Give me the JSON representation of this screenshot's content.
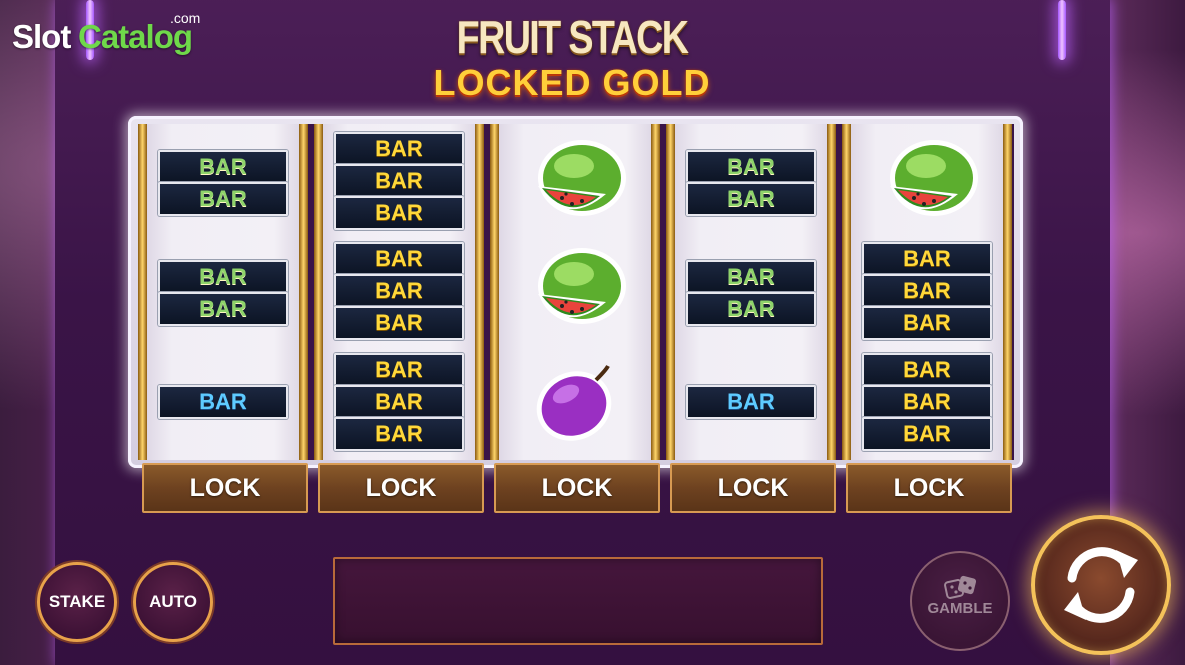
{
  "watermark": {
    "part1": "Slot",
    "part2": "Catalog",
    "suffix": ".com"
  },
  "game_title": {
    "line1": "FRUIT STACK",
    "line2": "LOCKED GOLD"
  },
  "reels": [
    {
      "symbols": [
        {
          "type": "bar",
          "label": "BAR",
          "color": "green"
        },
        {
          "type": "bar",
          "label": "BAR",
          "color": "green"
        },
        {
          "type": "bar",
          "label": "BAR",
          "color": "green"
        },
        {
          "type": "bar",
          "label": "BAR",
          "color": "green"
        },
        {
          "type": "bar",
          "label": "BAR",
          "color": "blue"
        }
      ]
    },
    {
      "symbols": [
        {
          "type": "bar",
          "label": "BAR",
          "color": "yellow"
        },
        {
          "type": "bar",
          "label": "BAR",
          "color": "yellow"
        },
        {
          "type": "bar",
          "label": "BAR",
          "color": "yellow"
        },
        {
          "type": "bar",
          "label": "BAR",
          "color": "yellow"
        },
        {
          "type": "bar",
          "label": "BAR",
          "color": "yellow"
        },
        {
          "type": "bar",
          "label": "BAR",
          "color": "yellow"
        },
        {
          "type": "bar",
          "label": "BAR",
          "color": "yellow"
        },
        {
          "type": "bar",
          "label": "BAR",
          "color": "yellow"
        },
        {
          "type": "bar",
          "label": "BAR",
          "color": "yellow"
        }
      ]
    },
    {
      "symbols": [
        {
          "type": "fruit",
          "icon": "watermelon-icon"
        },
        {
          "type": "fruit",
          "icon": "watermelon-icon"
        },
        {
          "type": "fruit",
          "icon": "plum-icon"
        }
      ]
    },
    {
      "symbols": [
        {
          "type": "bar",
          "label": "BAR",
          "color": "green"
        },
        {
          "type": "bar",
          "label": "BAR",
          "color": "green"
        },
        {
          "type": "bar",
          "label": "BAR",
          "color": "green"
        },
        {
          "type": "bar",
          "label": "BAR",
          "color": "green"
        },
        {
          "type": "bar",
          "label": "BAR",
          "color": "blue"
        }
      ]
    },
    {
      "symbols": [
        {
          "type": "fruit",
          "icon": "watermelon-icon"
        },
        {
          "type": "bar",
          "label": "BAR",
          "color": "yellow"
        },
        {
          "type": "bar",
          "label": "BAR",
          "color": "yellow"
        },
        {
          "type": "bar",
          "label": "BAR",
          "color": "yellow"
        },
        {
          "type": "bar",
          "label": "BAR",
          "color": "yellow"
        },
        {
          "type": "bar",
          "label": "BAR",
          "color": "yellow"
        },
        {
          "type": "bar",
          "label": "BAR",
          "color": "yellow"
        }
      ]
    }
  ],
  "lock_buttons": [
    "LOCK",
    "LOCK",
    "LOCK",
    "LOCK",
    "LOCK"
  ],
  "controls": {
    "stake_label": "STAKE",
    "auto_label": "AUTO",
    "gamble_label": "GAMBLE",
    "spin_icon": "spin-arrows-icon",
    "gamble_icon": "dice-icon"
  },
  "colors": {
    "bar_green": "#8ed36a",
    "bar_yellow": "#ffd83a",
    "bar_blue": "#5ecbff",
    "accent_gold": "#f4c25a"
  }
}
